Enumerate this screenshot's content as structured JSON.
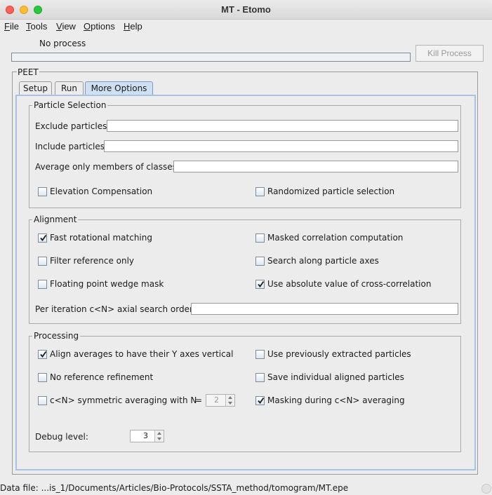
{
  "window": {
    "title": "MT - Etomo"
  },
  "menu": {
    "file": {
      "mnemonic": "F",
      "rest": "ile"
    },
    "tools": {
      "mnemonic": "T",
      "rest": "ools"
    },
    "view": {
      "mnemonic": "V",
      "rest": "iew"
    },
    "options": {
      "mnemonic": "O",
      "rest": "ptions"
    },
    "help": {
      "mnemonic": "H",
      "rest": "elp"
    }
  },
  "process": {
    "status": "No process",
    "progress": 0,
    "kill_label": "Kill Process"
  },
  "peet": {
    "label": "PEET",
    "tabs": [
      "Setup",
      "Run",
      "More Options"
    ],
    "active_tab": "More Options"
  },
  "particle_selection": {
    "title": "Particle Selection",
    "exclude_label": "Exclude particles",
    "exclude_value": "",
    "include_label": "Include particles",
    "include_value": "",
    "average_label": "Average only members of classes",
    "average_value": "",
    "elevation": {
      "label": "Elevation Compensation",
      "checked": false
    },
    "randomized": {
      "label": "Randomized particle selection",
      "checked": false
    }
  },
  "alignment": {
    "title": "Alignment",
    "fast_rotational": {
      "label": "Fast rotational matching",
      "checked": true
    },
    "masked_correlation": {
      "label": "Masked correlation computation",
      "checked": false
    },
    "filter_reference": {
      "label": "Filter reference only",
      "checked": false
    },
    "search_axes": {
      "label": "Search along particle axes",
      "checked": false
    },
    "floating_wedge": {
      "label": "Floating point wedge mask",
      "checked": false
    },
    "absolute_xcorr": {
      "label": "Use absolute value of cross-correlation",
      "checked": true
    },
    "axial_order_label": "Per iteration c<N> axial search order",
    "axial_order_value": ""
  },
  "processing": {
    "title": "Processing",
    "align_y": {
      "label": "Align averages to have their Y axes vertical",
      "checked": true
    },
    "use_extracted": {
      "label": "Use previously extracted particles",
      "checked": false
    },
    "no_ref_refine": {
      "label": "No reference refinement",
      "checked": false
    },
    "save_aligned": {
      "label": "Save individual aligned particles",
      "checked": false
    },
    "symmetric": {
      "label": "c<N> symmetric averaging with N",
      "equals": "=",
      "checked": false,
      "n_value": "2"
    },
    "masking_cn": {
      "label": "Masking during c<N> averaging",
      "checked": true
    },
    "debug_label": "Debug level:",
    "debug_value": "3"
  },
  "statusbar": {
    "text": "Data file: ...is_1/Documents/Articles/Bio-Protocols/SSTA_method/tomogram/MT.epe"
  }
}
